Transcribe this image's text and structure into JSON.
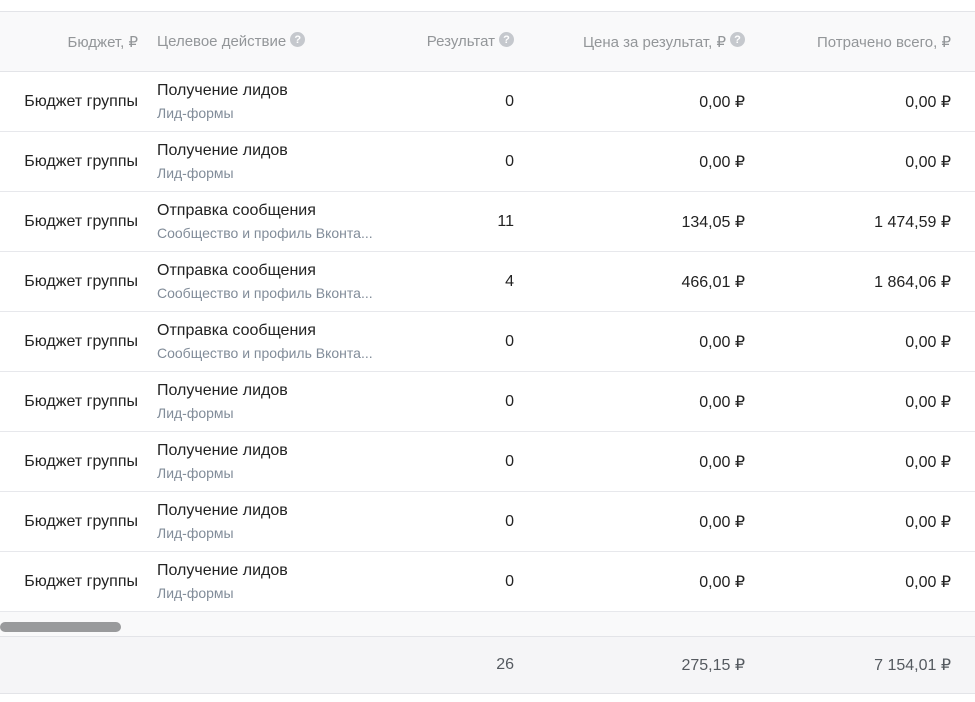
{
  "headers": {
    "budget": "Бюджет, ₽",
    "action": "Целевое действие",
    "result": "Результат",
    "price": "Цена за результат, ₽",
    "spent": "Потрачено всего, ₽",
    "help_glyph": "?"
  },
  "rows": [
    {
      "budget": "Бюджет группы",
      "action": "Получение лидов",
      "action_sub": "Лид-формы",
      "result": "0",
      "price": "0,00 ₽",
      "spent": "0,00 ₽"
    },
    {
      "budget": "Бюджет группы",
      "action": "Получение лидов",
      "action_sub": "Лид-формы",
      "result": "0",
      "price": "0,00 ₽",
      "spent": "0,00 ₽"
    },
    {
      "budget": "Бюджет группы",
      "action": "Отправка сообщения",
      "action_sub": "Сообщество и профиль Вконта...",
      "result": "11",
      "price": "134,05 ₽",
      "spent": "1 474,59 ₽"
    },
    {
      "budget": "Бюджет группы",
      "action": "Отправка сообщения",
      "action_sub": "Сообщество и профиль Вконта...",
      "result": "4",
      "price": "466,01 ₽",
      "spent": "1 864,06 ₽"
    },
    {
      "budget": "Бюджет группы",
      "action": "Отправка сообщения",
      "action_sub": "Сообщество и профиль Вконта...",
      "result": "0",
      "price": "0,00 ₽",
      "spent": "0,00 ₽"
    },
    {
      "budget": "Бюджет группы",
      "action": "Получение лидов",
      "action_sub": "Лид-формы",
      "result": "0",
      "price": "0,00 ₽",
      "spent": "0,00 ₽"
    },
    {
      "budget": "Бюджет группы",
      "action": "Получение лидов",
      "action_sub": "Лид-формы",
      "result": "0",
      "price": "0,00 ₽",
      "spent": "0,00 ₽"
    },
    {
      "budget": "Бюджет группы",
      "action": "Получение лидов",
      "action_sub": "Лид-формы",
      "result": "0",
      "price": "0,00 ₽",
      "spent": "0,00 ₽"
    },
    {
      "budget": "Бюджет группы",
      "action": "Получение лидов",
      "action_sub": "Лид-формы",
      "result": "0",
      "price": "0,00 ₽",
      "spent": "0,00 ₽"
    }
  ],
  "totals": {
    "result": "26",
    "price": "275,15 ₽",
    "spent": "7 154,01 ₽"
  }
}
